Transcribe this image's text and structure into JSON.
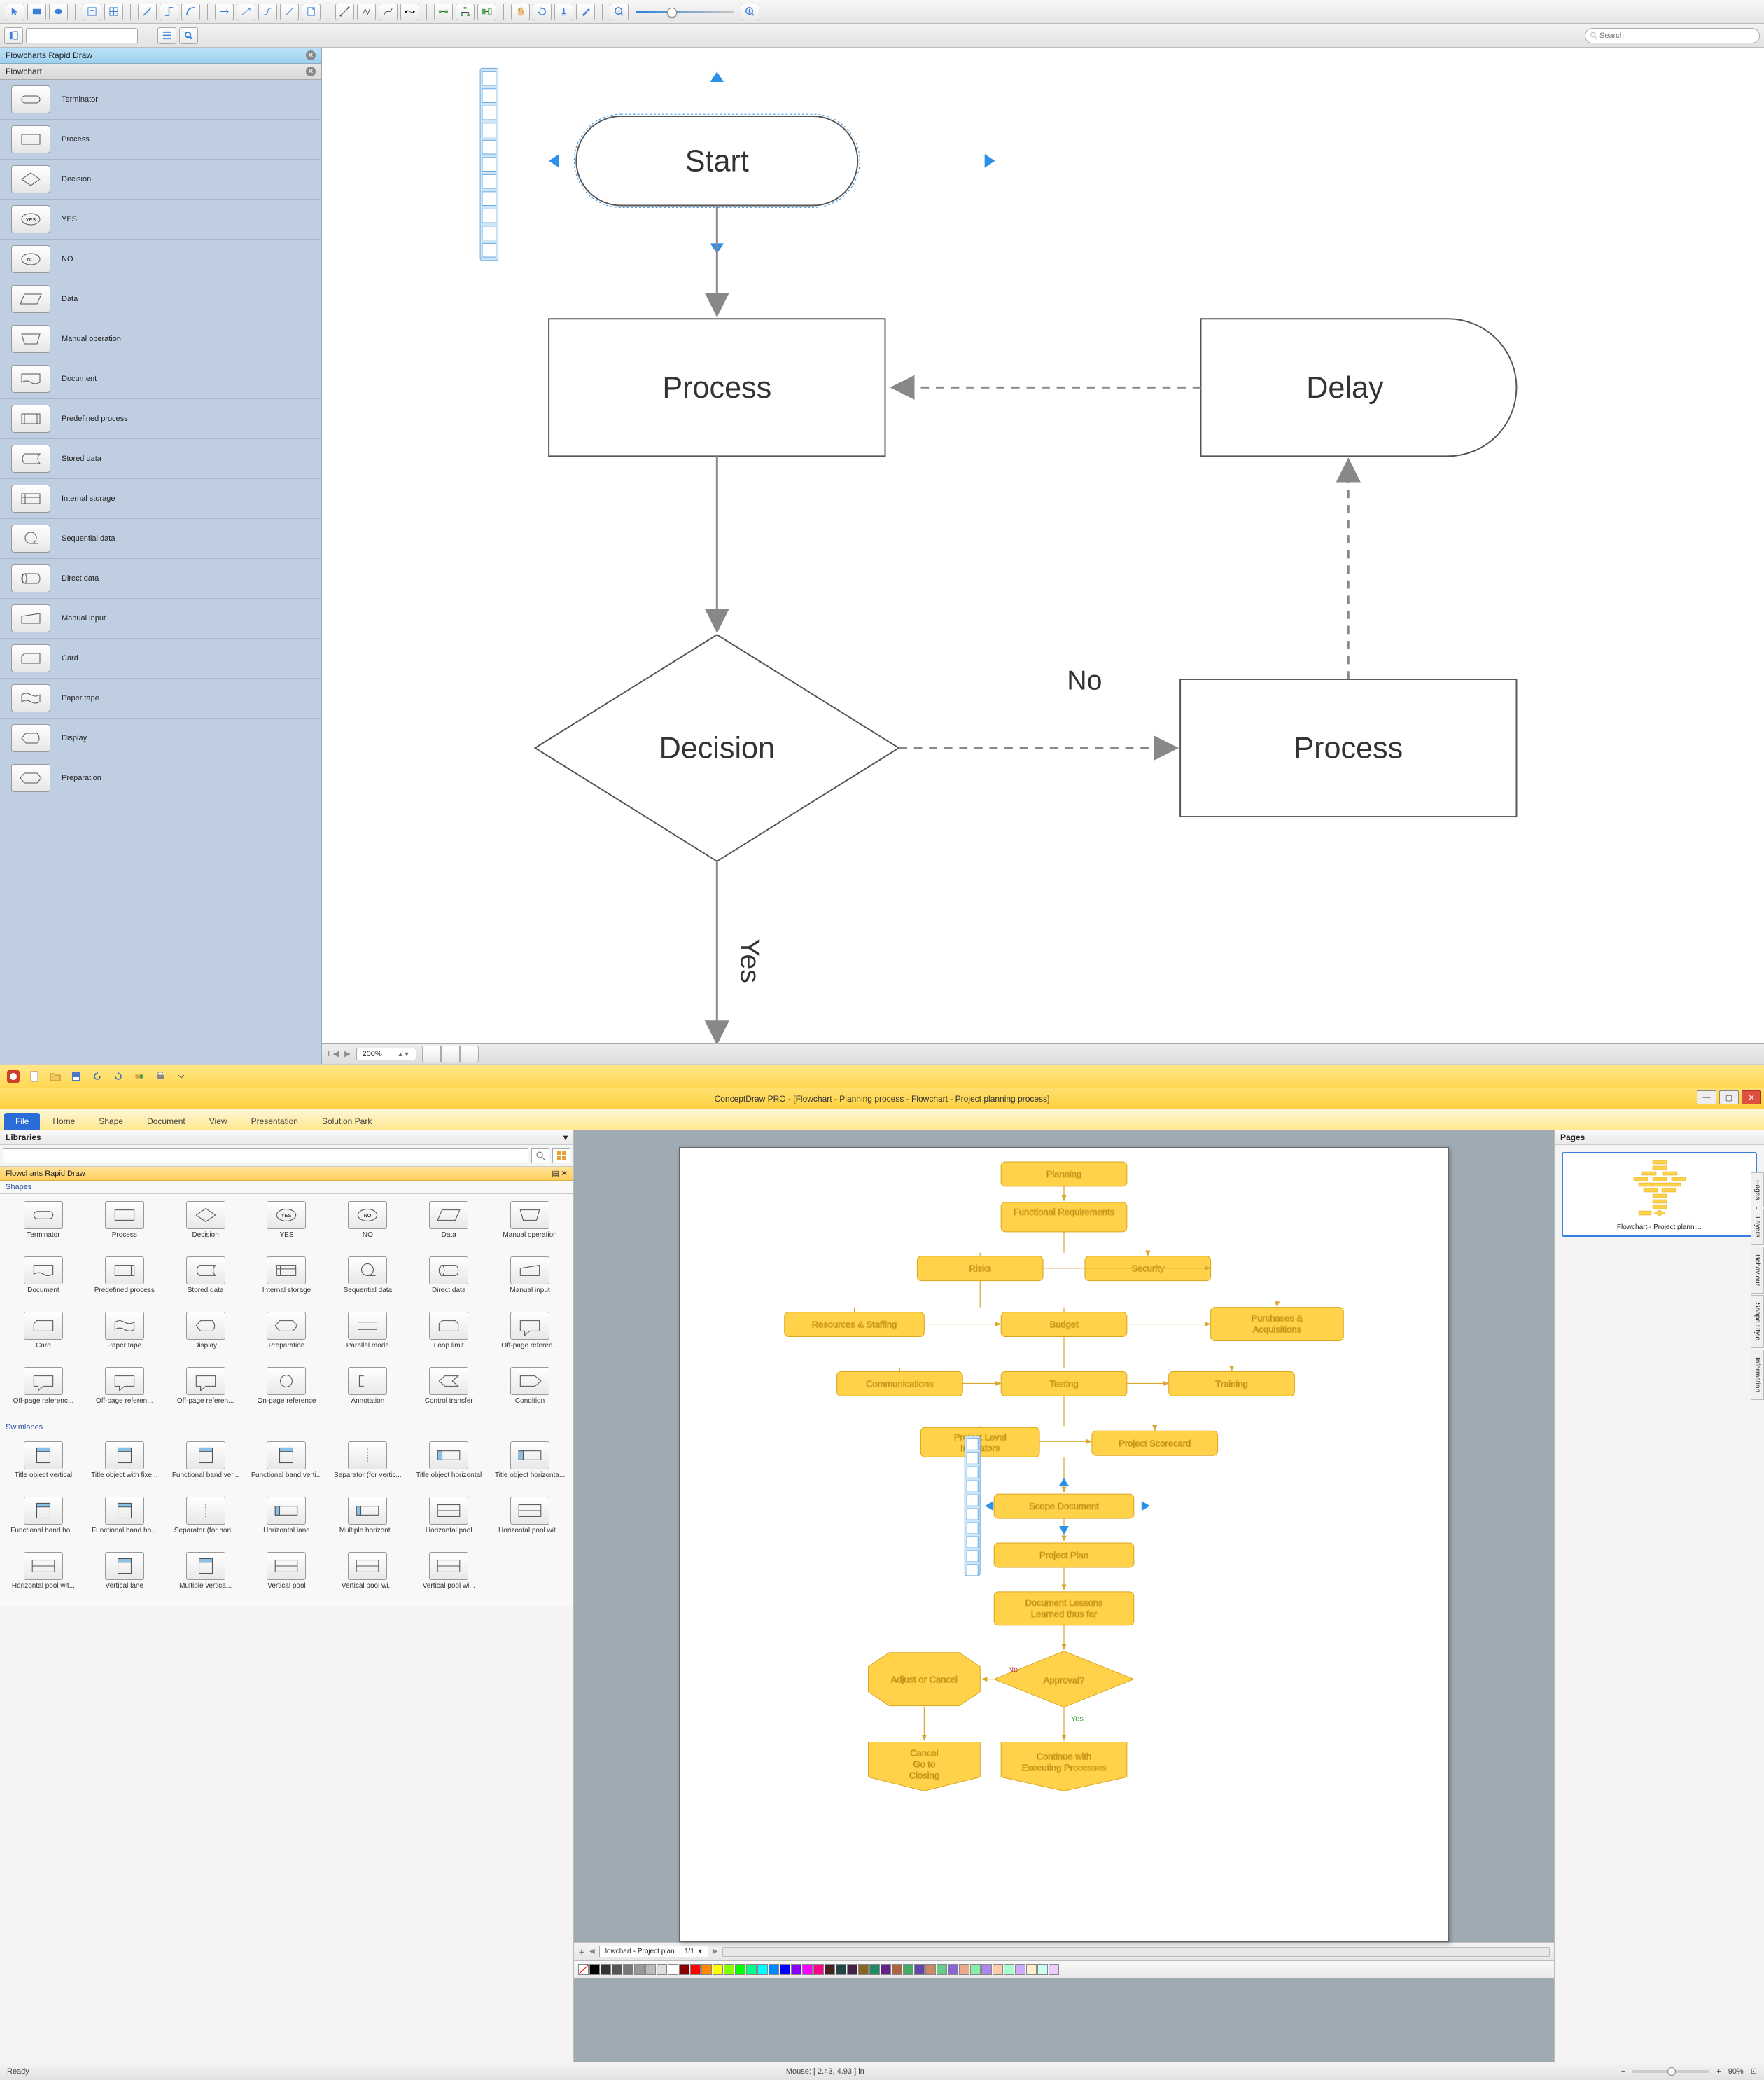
{
  "top_app": {
    "search_placeholder": "Search",
    "zoom_label": "200%",
    "libraries": [
      {
        "name": "Flowcharts Rapid Draw",
        "active": true
      },
      {
        "name": "Flowchart",
        "active": false
      }
    ],
    "shapes": [
      "Terminator",
      "Process",
      "Decision",
      "YES",
      "NO",
      "Data",
      "Manual operation",
      "Document",
      "Predefined process",
      "Stored data",
      "Internal storage",
      "Sequential data",
      "Direct data",
      "Manual input",
      "Card",
      "Paper tape",
      "Display",
      "Preparation"
    ],
    "flowchart": {
      "nodes": [
        {
          "id": "start",
          "type": "terminator",
          "label": "Start"
        },
        {
          "id": "proc1",
          "type": "process",
          "label": "Process"
        },
        {
          "id": "delay",
          "type": "delay",
          "label": "Delay"
        },
        {
          "id": "dec",
          "type": "decision",
          "label": "Decision"
        },
        {
          "id": "proc2",
          "type": "process",
          "label": "Process"
        }
      ],
      "edges": [
        {
          "from": "start",
          "to": "proc1",
          "style": "solid"
        },
        {
          "from": "proc1",
          "to": "dec",
          "style": "solid"
        },
        {
          "from": "delay",
          "to": "proc1",
          "style": "dashed"
        },
        {
          "from": "dec",
          "to": "proc2",
          "style": "dashed",
          "label": "No"
        },
        {
          "from": "proc2",
          "to": "delay",
          "style": "dashed"
        },
        {
          "from": "dec",
          "to": "down",
          "style": "solid",
          "label": "Yes"
        }
      ]
    }
  },
  "bottom_app": {
    "title": "ConceptDraw PRO - [Flowchart - Planning process - Flowchart - Project planning process]",
    "ribbon_tabs": [
      "File",
      "Home",
      "Shape",
      "Document",
      "View",
      "Presentation",
      "Solution Park"
    ],
    "active_tab": "File",
    "libraries_title": "Libraries",
    "lib_category": "Flowcharts Rapid Draw",
    "sections": {
      "shapes_label": "Shapes",
      "swimlanes_label": "Swimlanes"
    },
    "shapes": [
      "Terminator",
      "Process",
      "Decision",
      "YES",
      "NO",
      "Data",
      "Manual operation",
      "Document",
      "Predefined process",
      "Stored data",
      "Internal storage",
      "Sequential data",
      "Direct data",
      "Manual input",
      "Card",
      "Paper tape",
      "Display",
      "Preparation",
      "Parallel mode",
      "Loop limit",
      "Off-page referen...",
      "Off-page referenc...",
      "Off-page referen...",
      "Off-page referen...",
      "On-page reference",
      "Annotation",
      "Control transfer",
      "Condition"
    ],
    "swimlanes": [
      "Title object vertical",
      "Title object with fixe...",
      "Functional band ver...",
      "Functional band verti...",
      "Separator (for vertic...",
      "Title object horizontal",
      "Title object horizonta...",
      "Functional band ho...",
      "Functional band ho...",
      "Separator (for hori...",
      "Horizontal lane",
      "Multiple horizont...",
      "Horizontal pool",
      "Horizontal pool wit...",
      "Horizontal pool wit...",
      "Vertical lane",
      "Multiple vertica...",
      "Vertical pool",
      "Vertical pool wi...",
      "Vertical pool wi..."
    ],
    "pages_title": "Pages",
    "page_thumb_label": "Flowchart - Project planni...",
    "side_tabs": [
      "Pages",
      "Layers",
      "Behaviour",
      "Shape Style",
      "Information"
    ],
    "tab_name": "lowchart - Project plan...",
    "tab_counter": "1/1",
    "status_left": "Ready",
    "status_mouse": "Mouse: [ 2.43, 4.93 ] in",
    "status_zoom": "90%",
    "flowchart": {
      "nodes": [
        {
          "label": "Planning"
        },
        {
          "label": "Functional Requirements"
        },
        {
          "label": "Risks"
        },
        {
          "label": "Security"
        },
        {
          "label": "Resources & Staffing"
        },
        {
          "label": "Budget"
        },
        {
          "label": "Purchases & Acquisitions"
        },
        {
          "label": "Communications"
        },
        {
          "label": "Testing"
        },
        {
          "label": "Training"
        },
        {
          "label": "Project Level Indicators"
        },
        {
          "label": "Project Scorecard"
        },
        {
          "label": "Scope Document"
        },
        {
          "label": "Project Plan"
        },
        {
          "label": "Document Lessons Learned thus far"
        },
        {
          "label": "Approval?"
        },
        {
          "label": "Adjust or Cancel"
        },
        {
          "label": "Cancel Go to Closing"
        },
        {
          "label": "Continue with Executing Processes"
        }
      ],
      "edge_labels": {
        "no": "No",
        "yes": "Yes"
      }
    },
    "palette_colors": [
      "#000",
      "#333",
      "#555",
      "#777",
      "#999",
      "#bbb",
      "#ddd",
      "#fff",
      "#800",
      "#f00",
      "#f80",
      "#ff0",
      "#8f0",
      "#0f0",
      "#0f8",
      "#0ff",
      "#08f",
      "#00f",
      "#80f",
      "#f0f",
      "#f08",
      "#422",
      "#244",
      "#424",
      "#862",
      "#286",
      "#628",
      "#a64",
      "#4a6",
      "#64a",
      "#c86",
      "#6c8",
      "#86c",
      "#ea8",
      "#8ea",
      "#a8e",
      "#fca",
      "#afc",
      "#caf",
      "#fec",
      "#cfe",
      "#ecf"
    ]
  }
}
